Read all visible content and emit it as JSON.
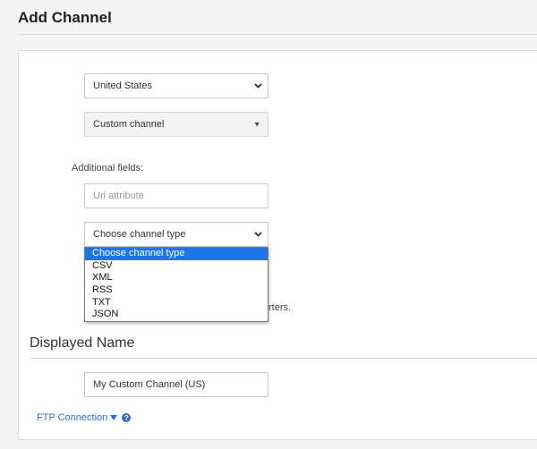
{
  "page": {
    "title": "Add Channel"
  },
  "form": {
    "country": {
      "value": "United States"
    },
    "channel": {
      "value": "Custom channel"
    },
    "additional_fields_label": "Additional fields:",
    "url_attribute": {
      "placeholder": "Url attribute",
      "value": ""
    },
    "channel_type": {
      "value": "Choose channel type",
      "options": [
        "Choose channel type",
        "CSV",
        "XML",
        "RSS",
        "TXT",
        "JSON"
      ],
      "selected_index": 0
    },
    "obscured_text": "rters."
  },
  "displayed_name": {
    "section_title": "Displayed Name",
    "value": "My Custom Channel (US)"
  },
  "ftp": {
    "link_label": "FTP Connection",
    "toggle_icon": "caret-down-icon",
    "help_icon": "help-icon"
  },
  "colors": {
    "link": "#2a6fd6",
    "selected_option": "#1e75e6"
  }
}
